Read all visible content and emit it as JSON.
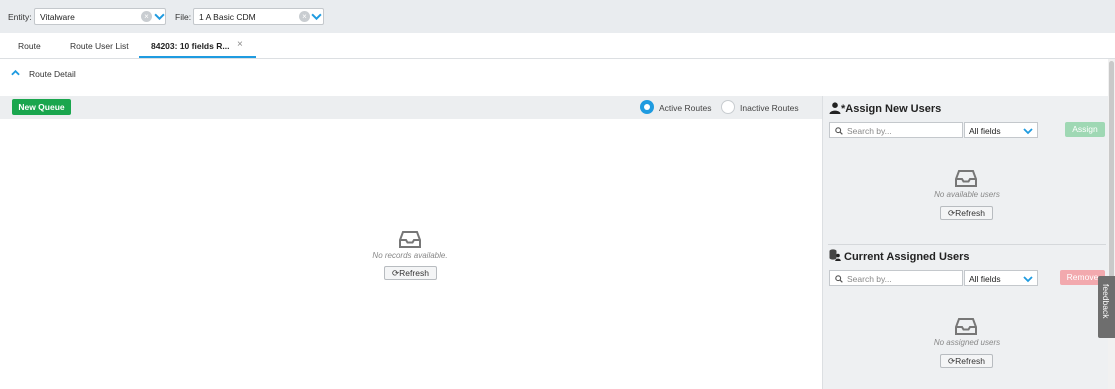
{
  "filters": {
    "entity_label": "Entity:",
    "entity_value": "Vitalware",
    "file_label": "File:",
    "file_value": "1 A Basic CDM"
  },
  "tabs": [
    {
      "label": "Route"
    },
    {
      "label": "Route User List"
    },
    {
      "label": "84203: 10 fields R...",
      "active": true,
      "closable": true
    }
  ],
  "route_detail": {
    "label": "Route Detail"
  },
  "queue": {
    "new_queue_label": "New Queue",
    "active_routes_label": "Active Routes",
    "inactive_routes_label": "Inactive Routes",
    "selected": "Active Routes",
    "empty_text": "No records available.",
    "refresh_label": "Refresh"
  },
  "assign_new_users": {
    "title": "*Assign New Users",
    "search_placeholder": "Search by...",
    "field_select": "All fields",
    "assign_label": "Assign",
    "empty_text": "No available users",
    "refresh_label": "Refresh"
  },
  "current_assigned_users": {
    "title": "Current Assigned Users",
    "search_placeholder": "Search by...",
    "field_select": "All fields",
    "remove_label": "Remove",
    "empty_text": "No assigned users",
    "refresh_label": "Refresh"
  },
  "feedback_label": "feedback",
  "colors": {
    "accent": "#1f9be0",
    "primary_button": "#1aa64e",
    "assign_disabled": "#9fd8b4",
    "remove_disabled": "#f2a9ae"
  }
}
